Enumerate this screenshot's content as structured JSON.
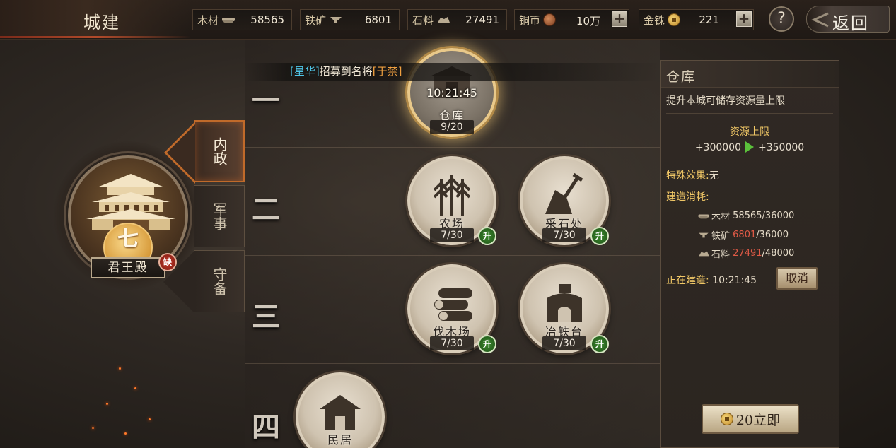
{
  "header": {
    "title": "城建",
    "back_label": "返回",
    "help_label": "?"
  },
  "resources": [
    {
      "label": "木材",
      "icon": "wood-icon",
      "value": "58565"
    },
    {
      "label": "铁矿",
      "icon": "iron-anvil-icon",
      "value": "6801"
    },
    {
      "label": "石料",
      "icon": "stone-icon",
      "value": "27491"
    },
    {
      "label": "铜币",
      "icon": "copper-coin-icon",
      "value": "10万",
      "has_plus": true
    },
    {
      "label": "金铢",
      "icon": "gold-coin-icon",
      "value": "221",
      "has_plus": true
    }
  ],
  "palace": {
    "name": "君王殿",
    "level": "七",
    "badge": "缺"
  },
  "tabs": [
    {
      "label": "内政",
      "active": true
    },
    {
      "label": "军事",
      "active": false
    },
    {
      "label": "守备",
      "active": false
    }
  ],
  "ticker": {
    "part1": "[星华]",
    "part2": "招募到名将",
    "part3": "[于禁]"
  },
  "rows": [
    {
      "numeral": "一"
    },
    {
      "numeral": "二"
    },
    {
      "numeral": "三"
    },
    {
      "numeral": "四"
    }
  ],
  "buildings": {
    "warehouse": {
      "name": "仓库",
      "level": "9/20",
      "timer": "10:21:45"
    },
    "farm": {
      "name": "农场",
      "level": "7/30",
      "upgrade": "升"
    },
    "quarry": {
      "name": "采石处",
      "level": "7/30",
      "upgrade": "升"
    },
    "lumber": {
      "name": "伐木场",
      "level": "7/30",
      "upgrade": "升"
    },
    "smelter": {
      "name": "冶铁台",
      "level": "7/30",
      "upgrade": "升"
    },
    "residence": {
      "name": "民居"
    }
  },
  "panel": {
    "title": "仓库",
    "description": "提升本城可储存资源量上限",
    "cap_title": "资源上限",
    "cap_from": "+300000",
    "cap_to": "+350000",
    "special_label": "特殊效果:",
    "special_value": "无",
    "cost_title": "建造消耗:",
    "costs": [
      {
        "label": "木材",
        "have": "58565",
        "need": "/36000",
        "short": false
      },
      {
        "label": "铁矿",
        "have": "6801",
        "need": "/36000",
        "short": true
      },
      {
        "label": "石料",
        "have": "27491",
        "need": "/48000",
        "short": true
      }
    ],
    "building_label": "正在建造:",
    "building_time": "10:21:45",
    "cancel_label": "取消",
    "instant_label": "20立即"
  },
  "colors": {
    "accent_gold": "#f0c766",
    "shortage_red": "#e05a46",
    "upgrade_green": "#3c8a2e",
    "ticker_name": "#4fc6e8",
    "ticker_hero": "#f0a040"
  }
}
